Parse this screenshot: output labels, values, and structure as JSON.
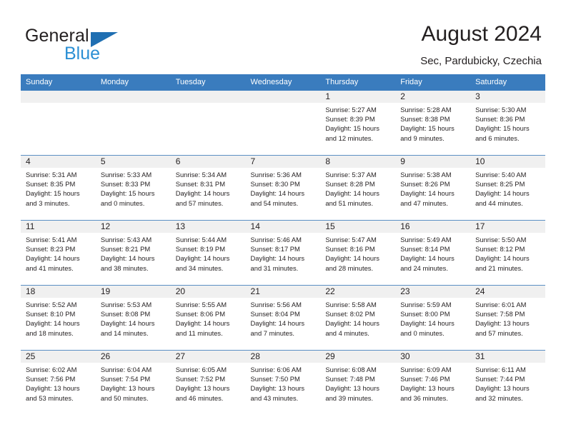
{
  "brand": {
    "name_part1": "General",
    "name_part2": "Blue",
    "triangle_color": "#1f6fb2",
    "blue_color": "#2b8fd4"
  },
  "header": {
    "title": "August 2024",
    "subtitle": "Sec, Pardubicky, Czechia"
  },
  "calendar": {
    "header_bg": "#3a7cbe",
    "daynum_bg": "#f0f0f0",
    "weekdays": [
      "Sunday",
      "Monday",
      "Tuesday",
      "Wednesday",
      "Thursday",
      "Friday",
      "Saturday"
    ],
    "labels": {
      "sunrise": "Sunrise:",
      "sunset": "Sunset:",
      "daylight": "Daylight:"
    },
    "weeks": [
      [
        {
          "day": "",
          "empty": true
        },
        {
          "day": "",
          "empty": true
        },
        {
          "day": "",
          "empty": true
        },
        {
          "day": "",
          "empty": true
        },
        {
          "day": "1",
          "sunrise": "Sunrise: 5:27 AM",
          "sunset": "Sunset: 8:39 PM",
          "daylight_line1": "Daylight: 15 hours",
          "daylight_line2": "and 12 minutes."
        },
        {
          "day": "2",
          "sunrise": "Sunrise: 5:28 AM",
          "sunset": "Sunset: 8:38 PM",
          "daylight_line1": "Daylight: 15 hours",
          "daylight_line2": "and 9 minutes."
        },
        {
          "day": "3",
          "sunrise": "Sunrise: 5:30 AM",
          "sunset": "Sunset: 8:36 PM",
          "daylight_line1": "Daylight: 15 hours",
          "daylight_line2": "and 6 minutes."
        }
      ],
      [
        {
          "day": "4",
          "sunrise": "Sunrise: 5:31 AM",
          "sunset": "Sunset: 8:35 PM",
          "daylight_line1": "Daylight: 15 hours",
          "daylight_line2": "and 3 minutes."
        },
        {
          "day": "5",
          "sunrise": "Sunrise: 5:33 AM",
          "sunset": "Sunset: 8:33 PM",
          "daylight_line1": "Daylight: 15 hours",
          "daylight_line2": "and 0 minutes."
        },
        {
          "day": "6",
          "sunrise": "Sunrise: 5:34 AM",
          "sunset": "Sunset: 8:31 PM",
          "daylight_line1": "Daylight: 14 hours",
          "daylight_line2": "and 57 minutes."
        },
        {
          "day": "7",
          "sunrise": "Sunrise: 5:36 AM",
          "sunset": "Sunset: 8:30 PM",
          "daylight_line1": "Daylight: 14 hours",
          "daylight_line2": "and 54 minutes."
        },
        {
          "day": "8",
          "sunrise": "Sunrise: 5:37 AM",
          "sunset": "Sunset: 8:28 PM",
          "daylight_line1": "Daylight: 14 hours",
          "daylight_line2": "and 51 minutes."
        },
        {
          "day": "9",
          "sunrise": "Sunrise: 5:38 AM",
          "sunset": "Sunset: 8:26 PM",
          "daylight_line1": "Daylight: 14 hours",
          "daylight_line2": "and 47 minutes."
        },
        {
          "day": "10",
          "sunrise": "Sunrise: 5:40 AM",
          "sunset": "Sunset: 8:25 PM",
          "daylight_line1": "Daylight: 14 hours",
          "daylight_line2": "and 44 minutes."
        }
      ],
      [
        {
          "day": "11",
          "sunrise": "Sunrise: 5:41 AM",
          "sunset": "Sunset: 8:23 PM",
          "daylight_line1": "Daylight: 14 hours",
          "daylight_line2": "and 41 minutes."
        },
        {
          "day": "12",
          "sunrise": "Sunrise: 5:43 AM",
          "sunset": "Sunset: 8:21 PM",
          "daylight_line1": "Daylight: 14 hours",
          "daylight_line2": "and 38 minutes."
        },
        {
          "day": "13",
          "sunrise": "Sunrise: 5:44 AM",
          "sunset": "Sunset: 8:19 PM",
          "daylight_line1": "Daylight: 14 hours",
          "daylight_line2": "and 34 minutes."
        },
        {
          "day": "14",
          "sunrise": "Sunrise: 5:46 AM",
          "sunset": "Sunset: 8:17 PM",
          "daylight_line1": "Daylight: 14 hours",
          "daylight_line2": "and 31 minutes."
        },
        {
          "day": "15",
          "sunrise": "Sunrise: 5:47 AM",
          "sunset": "Sunset: 8:16 PM",
          "daylight_line1": "Daylight: 14 hours",
          "daylight_line2": "and 28 minutes."
        },
        {
          "day": "16",
          "sunrise": "Sunrise: 5:49 AM",
          "sunset": "Sunset: 8:14 PM",
          "daylight_line1": "Daylight: 14 hours",
          "daylight_line2": "and 24 minutes."
        },
        {
          "day": "17",
          "sunrise": "Sunrise: 5:50 AM",
          "sunset": "Sunset: 8:12 PM",
          "daylight_line1": "Daylight: 14 hours",
          "daylight_line2": "and 21 minutes."
        }
      ],
      [
        {
          "day": "18",
          "sunrise": "Sunrise: 5:52 AM",
          "sunset": "Sunset: 8:10 PM",
          "daylight_line1": "Daylight: 14 hours",
          "daylight_line2": "and 18 minutes."
        },
        {
          "day": "19",
          "sunrise": "Sunrise: 5:53 AM",
          "sunset": "Sunset: 8:08 PM",
          "daylight_line1": "Daylight: 14 hours",
          "daylight_line2": "and 14 minutes."
        },
        {
          "day": "20",
          "sunrise": "Sunrise: 5:55 AM",
          "sunset": "Sunset: 8:06 PM",
          "daylight_line1": "Daylight: 14 hours",
          "daylight_line2": "and 11 minutes."
        },
        {
          "day": "21",
          "sunrise": "Sunrise: 5:56 AM",
          "sunset": "Sunset: 8:04 PM",
          "daylight_line1": "Daylight: 14 hours",
          "daylight_line2": "and 7 minutes."
        },
        {
          "day": "22",
          "sunrise": "Sunrise: 5:58 AM",
          "sunset": "Sunset: 8:02 PM",
          "daylight_line1": "Daylight: 14 hours",
          "daylight_line2": "and 4 minutes."
        },
        {
          "day": "23",
          "sunrise": "Sunrise: 5:59 AM",
          "sunset": "Sunset: 8:00 PM",
          "daylight_line1": "Daylight: 14 hours",
          "daylight_line2": "and 0 minutes."
        },
        {
          "day": "24",
          "sunrise": "Sunrise: 6:01 AM",
          "sunset": "Sunset: 7:58 PM",
          "daylight_line1": "Daylight: 13 hours",
          "daylight_line2": "and 57 minutes."
        }
      ],
      [
        {
          "day": "25",
          "sunrise": "Sunrise: 6:02 AM",
          "sunset": "Sunset: 7:56 PM",
          "daylight_line1": "Daylight: 13 hours",
          "daylight_line2": "and 53 minutes."
        },
        {
          "day": "26",
          "sunrise": "Sunrise: 6:04 AM",
          "sunset": "Sunset: 7:54 PM",
          "daylight_line1": "Daylight: 13 hours",
          "daylight_line2": "and 50 minutes."
        },
        {
          "day": "27",
          "sunrise": "Sunrise: 6:05 AM",
          "sunset": "Sunset: 7:52 PM",
          "daylight_line1": "Daylight: 13 hours",
          "daylight_line2": "and 46 minutes."
        },
        {
          "day": "28",
          "sunrise": "Sunrise: 6:06 AM",
          "sunset": "Sunset: 7:50 PM",
          "daylight_line1": "Daylight: 13 hours",
          "daylight_line2": "and 43 minutes."
        },
        {
          "day": "29",
          "sunrise": "Sunrise: 6:08 AM",
          "sunset": "Sunset: 7:48 PM",
          "daylight_line1": "Daylight: 13 hours",
          "daylight_line2": "and 39 minutes."
        },
        {
          "day": "30",
          "sunrise": "Sunrise: 6:09 AM",
          "sunset": "Sunset: 7:46 PM",
          "daylight_line1": "Daylight: 13 hours",
          "daylight_line2": "and 36 minutes."
        },
        {
          "day": "31",
          "sunrise": "Sunrise: 6:11 AM",
          "sunset": "Sunset: 7:44 PM",
          "daylight_line1": "Daylight: 13 hours",
          "daylight_line2": "and 32 minutes."
        }
      ]
    ]
  }
}
